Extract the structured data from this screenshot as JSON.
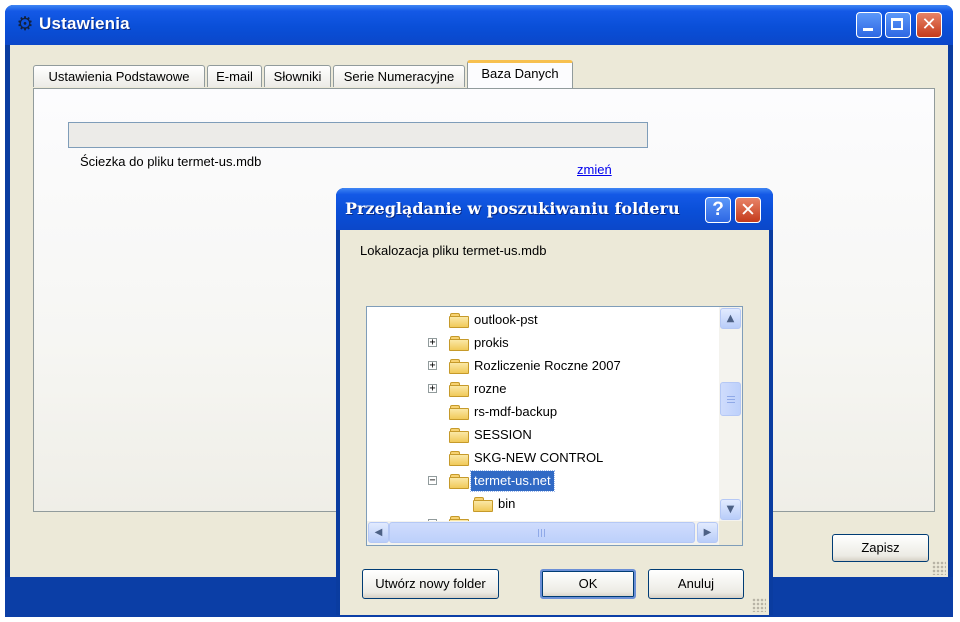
{
  "window": {
    "title": "Ustawienia",
    "title_icon": "gears-icon",
    "controls": {
      "minimize": "minimize-icon",
      "maximize": "maximize-icon",
      "close": "✕"
    }
  },
  "tabs": [
    {
      "label": "Ustawienia Podstawowe",
      "active": false
    },
    {
      "label": "E-mail",
      "active": false
    },
    {
      "label": "Słowniki",
      "active": false
    },
    {
      "label": "Serie Numeracyjne",
      "active": false
    },
    {
      "label": "Baza Danych",
      "active": true
    }
  ],
  "database_tab": {
    "path_value": "",
    "path_label": "Ściezka do pliku termet-us.mdb",
    "change_link": "zmień"
  },
  "save_button": "Zapisz",
  "dialog": {
    "title": "Przeglądanie w poszukiwaniu folderu",
    "help_label": "?",
    "close_label": "✕",
    "prompt": "Lokalozacja pliku termet-us.mdb",
    "tree": [
      {
        "label": "outlook-pst",
        "expander": "",
        "depth": 1,
        "selected": false
      },
      {
        "label": "prokis",
        "expander": "+",
        "depth": 1,
        "selected": false
      },
      {
        "label": "Rozliczenie Roczne 2007",
        "expander": "+",
        "depth": 1,
        "selected": false
      },
      {
        "label": "rozne",
        "expander": "+",
        "depth": 1,
        "selected": false
      },
      {
        "label": "rs-mdf-backup",
        "expander": "",
        "depth": 1,
        "selected": false
      },
      {
        "label": "SESSION",
        "expander": "",
        "depth": 1,
        "selected": false
      },
      {
        "label": "SKG-NEW CONTROL",
        "expander": "",
        "depth": 1,
        "selected": false
      },
      {
        "label": "termet-us.net",
        "expander": "−",
        "depth": 1,
        "selected": true
      },
      {
        "label": "bin",
        "expander": "",
        "depth": 2,
        "selected": false
      }
    ],
    "buttons": {
      "new_folder": "Utwórz nowy folder",
      "ok": "OK",
      "cancel": "Anuluj"
    }
  },
  "colors": {
    "titlebar": "#0a4fd8",
    "selection": "#316ac5",
    "active_tab_accent": "#f7c04f",
    "link": "#0000ee",
    "close_button": "#c43a1b"
  }
}
